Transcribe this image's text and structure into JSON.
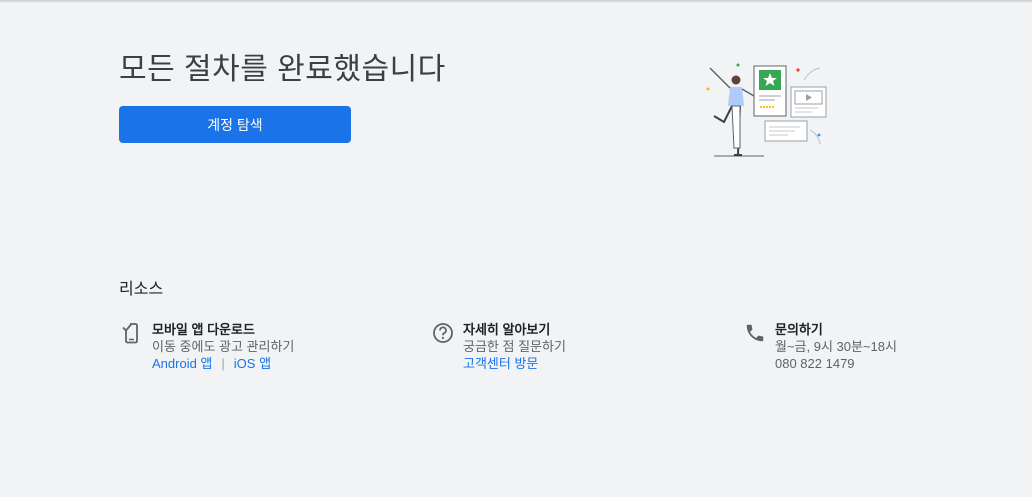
{
  "page": {
    "title": "모든 절차를 완료했습니다",
    "explore_button": "계정 탐색"
  },
  "resources": {
    "heading": "리소스",
    "mobile": {
      "title": "모바일 앱 다운로드",
      "description": "이동 중에도 광고 관리하기",
      "android_link": "Android 앱",
      "separator": "|",
      "ios_link": "iOS 앱",
      "icon": "phone-download-icon"
    },
    "learn": {
      "title": "자세히 알아보기",
      "description": "궁금한 점 질문하기",
      "help_link": "고객센터 방문",
      "icon": "help-circle-icon"
    },
    "contact": {
      "title": "문의하기",
      "hours": "월~금, 9시 30분~18시",
      "phone": "080 822 1479",
      "icon": "phone-icon"
    }
  },
  "colors": {
    "accent": "#1a73e8",
    "background": "#f1f3f4",
    "illustration_green": "#34a853",
    "illustration_yellow": "#fbbc04",
    "illustration_red": "#ea4335"
  }
}
